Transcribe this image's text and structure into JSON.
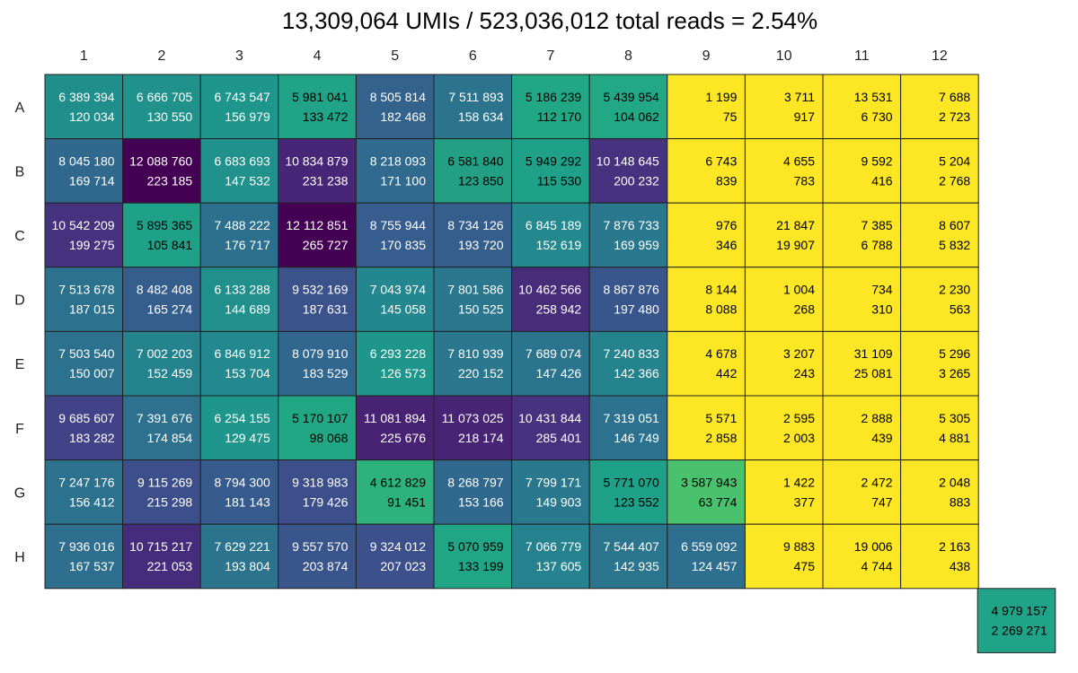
{
  "chart_data": {
    "type": "heatmap",
    "title": "13,309,064 UMIs / 523,036,012 total reads = 2.54%",
    "columns": [
      "1",
      "2",
      "3",
      "4",
      "5",
      "6",
      "7",
      "8",
      "9",
      "10",
      "11",
      "12"
    ],
    "rows": [
      "A",
      "B",
      "C",
      "D",
      "E",
      "F",
      "G",
      "H"
    ],
    "colormap": "viridis",
    "cells": [
      [
        [
          "6 389 394",
          "120 034"
        ],
        [
          "6 666 705",
          "130 550"
        ],
        [
          "6 743 547",
          "156 979"
        ],
        [
          "5 981 041",
          "133 472"
        ],
        [
          "8 505 814",
          "182 468"
        ],
        [
          "7 511 893",
          "158 634"
        ],
        [
          "5 186 239",
          "112 170"
        ],
        [
          "5 439 954",
          "104 062"
        ],
        [
          "1 199",
          "75"
        ],
        [
          "3 711",
          "917"
        ],
        [
          "13 531",
          "6 730"
        ],
        [
          "7 688",
          "2 723"
        ]
      ],
      [
        [
          "8 045 180",
          "169 714"
        ],
        [
          "12 088 760",
          "223 185"
        ],
        [
          "6 683 693",
          "147 532"
        ],
        [
          "10 834 879",
          "231 238"
        ],
        [
          "8 218 093",
          "171 100"
        ],
        [
          "6 581 840",
          "123 850"
        ],
        [
          "5 949 292",
          "115 530"
        ],
        [
          "10 148 645",
          "200 232"
        ],
        [
          "6 743",
          "839"
        ],
        [
          "4 655",
          "783"
        ],
        [
          "9 592",
          "416"
        ],
        [
          "5 204",
          "2 768"
        ]
      ],
      [
        [
          "10 542 209",
          "199 275"
        ],
        [
          "5 895 365",
          "105 841"
        ],
        [
          "7 488 222",
          "176 717"
        ],
        [
          "12 112 851",
          "265 727"
        ],
        [
          "8 755 944",
          "170 835"
        ],
        [
          "8 734 126",
          "193 720"
        ],
        [
          "6 845 189",
          "152 619"
        ],
        [
          "7 876 733",
          "169 959"
        ],
        [
          "976",
          "346"
        ],
        [
          "21 847",
          "19 907"
        ],
        [
          "7 385",
          "6 788"
        ],
        [
          "8 607",
          "5 832"
        ]
      ],
      [
        [
          "7 513 678",
          "187 015"
        ],
        [
          "8 482 408",
          "165 274"
        ],
        [
          "6 133 288",
          "144 689"
        ],
        [
          "9 532 169",
          "187 631"
        ],
        [
          "7 043 974",
          "145 058"
        ],
        [
          "7 801 586",
          "150 525"
        ],
        [
          "10 462 566",
          "258 942"
        ],
        [
          "8 867 876",
          "197 480"
        ],
        [
          "8 144",
          "8 088"
        ],
        [
          "1 004",
          "268"
        ],
        [
          "734",
          "310"
        ],
        [
          "2 230",
          "563"
        ]
      ],
      [
        [
          "7 503 540",
          "150 007"
        ],
        [
          "7 002 203",
          "152 459"
        ],
        [
          "6 846 912",
          "153 704"
        ],
        [
          "8 079 910",
          "183 529"
        ],
        [
          "6 293 228",
          "126 573"
        ],
        [
          "7 810 939",
          "220 152"
        ],
        [
          "7 689 074",
          "147 426"
        ],
        [
          "7 240 833",
          "142 366"
        ],
        [
          "4 678",
          "442"
        ],
        [
          "3 207",
          "243"
        ],
        [
          "31 109",
          "25 081"
        ],
        [
          "5 296",
          "3 265"
        ]
      ],
      [
        [
          "9 685 607",
          "183 282"
        ],
        [
          "7 391 676",
          "174 854"
        ],
        [
          "6 254 155",
          "129 475"
        ],
        [
          "5 170 107",
          "98 068"
        ],
        [
          "11 081 894",
          "225 676"
        ],
        [
          "11 073 025",
          "218 174"
        ],
        [
          "10 431 844",
          "285 401"
        ],
        [
          "7 319 051",
          "146 749"
        ],
        [
          "5 571",
          "2 858"
        ],
        [
          "2 595",
          "2 003"
        ],
        [
          "2 888",
          "439"
        ],
        [
          "5 305",
          "4 881"
        ]
      ],
      [
        [
          "7 247 176",
          "156 412"
        ],
        [
          "9 115 269",
          "215 298"
        ],
        [
          "8 794 300",
          "181 143"
        ],
        [
          "9 318 983",
          "179 426"
        ],
        [
          "4 612 829",
          "91 451"
        ],
        [
          "8 268 797",
          "153 166"
        ],
        [
          "7 799 171",
          "149 903"
        ],
        [
          "5 771 070",
          "123 552"
        ],
        [
          "3 587 943",
          "63 774"
        ],
        [
          "1 422",
          "377"
        ],
        [
          "2 472",
          "747"
        ],
        [
          "2 048",
          "883"
        ]
      ],
      [
        [
          "7 936 016",
          "167 537"
        ],
        [
          "10 715 217",
          "221 053"
        ],
        [
          "7 629 221",
          "193 804"
        ],
        [
          "9 557 570",
          "203 874"
        ],
        [
          "9 324 012",
          "207 023"
        ],
        [
          "5 070 959",
          "133 199"
        ],
        [
          "7 066 779",
          "137 605"
        ],
        [
          "7 544 407",
          "142 935"
        ],
        [
          "6 559 092",
          "124 457"
        ],
        [
          "9 883",
          "475"
        ],
        [
          "19 006",
          "4 744"
        ],
        [
          "2 163",
          "438"
        ]
      ]
    ],
    "extra_cell": [
      "4 979 157",
      "2 269 271"
    ],
    "colors": {
      "A": [
        "#208f8c",
        "#21918c",
        "#1f968b",
        "#20a386",
        "#33628d",
        "#2c738e",
        "#22a785",
        "#22a884",
        "#fde725",
        "#fde725",
        "#fde725",
        "#fde725"
      ],
      "B": [
        "#31688e",
        "#440154",
        "#21918c",
        "#482677",
        "#306a8e",
        "#23a083",
        "#1fa088",
        "#46327e",
        "#fde725",
        "#fde725",
        "#fde725",
        "#fde725"
      ],
      "C": [
        "#46337f",
        "#1fa188",
        "#2d708e",
        "#440154",
        "#365d8d",
        "#355e8d",
        "#23898e",
        "#2a788e",
        "#fde725",
        "#fde725",
        "#fde725",
        "#fde725"
      ],
      "D": [
        "#2c728e",
        "#355e8d",
        "#21908d",
        "#3b528b",
        "#24868e",
        "#2a778e",
        "#472c7a",
        "#39568c",
        "#fde725",
        "#fde725",
        "#fde725",
        "#fde725"
      ],
      "E": [
        "#2c728e",
        "#25838e",
        "#23898e",
        "#31678e",
        "#1f968b",
        "#2a778e",
        "#2b748e",
        "#25838e",
        "#fde725",
        "#fde725",
        "#fde725",
        "#fde725"
      ],
      "F": [
        "#414287",
        "#2d718e",
        "#1f968b",
        "#22a785",
        "#482374",
        "#482475",
        "#46337f",
        "#2c728e",
        "#fde725",
        "#fde725",
        "#fde725",
        "#fde725"
      ],
      "G": [
        "#2c728e",
        "#3c4f8a",
        "#375b8d",
        "#3c4f8a",
        "#2db27d",
        "#31688e",
        "#2a788e",
        "#1fa088",
        "#4ac16d",
        "#fde725",
        "#fde725",
        "#fde725"
      ],
      "H": [
        "#2e6e8e",
        "#462d7b",
        "#2c738e",
        "#3a548c",
        "#3c508b",
        "#21a685",
        "#26828e",
        "#2b758e",
        "#2e6e8e",
        "#fde725",
        "#fde725",
        "#fde725"
      ],
      "extra": "#20a386",
      "light_text": "#ffffff",
      "dark_text": "#000000",
      "grid_line": "#222222"
    }
  }
}
